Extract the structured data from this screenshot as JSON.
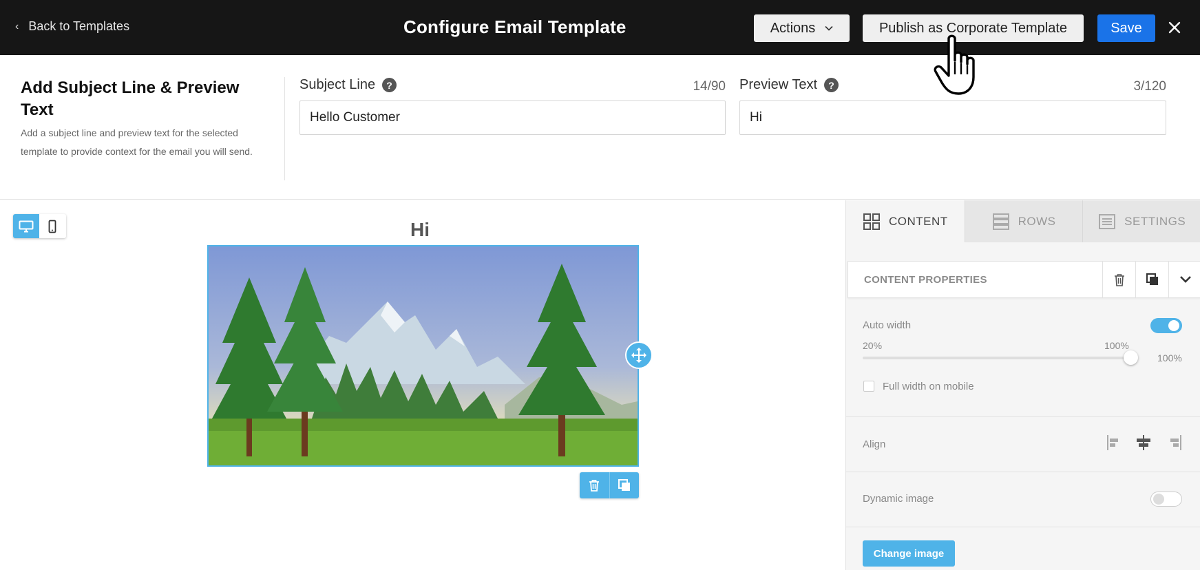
{
  "header": {
    "back_label": "Back to Templates",
    "title": "Configure Email Template",
    "actions_label": "Actions",
    "publish_label": "Publish as Corporate Template",
    "save_label": "Save"
  },
  "subject_section": {
    "title": "Add Subject Line & Preview Text",
    "description": "Add a subject line and preview text for the selected template to provide context for the email you will send.",
    "subject_line": {
      "label": "Subject Line",
      "counter": "14/90",
      "value": "Hello Customer"
    },
    "preview_text": {
      "label": "Preview Text",
      "counter": "3/120",
      "value": "Hi"
    }
  },
  "canvas": {
    "heading": "Hi",
    "devices": [
      "desktop",
      "mobile"
    ],
    "active_device": "desktop"
  },
  "panel": {
    "tabs": [
      {
        "label": "CONTENT",
        "icon": "grid-icon",
        "active": true
      },
      {
        "label": "ROWS",
        "icon": "rows-icon",
        "active": false
      },
      {
        "label": "SETTINGS",
        "icon": "settings-icon",
        "active": false
      }
    ],
    "properties_title": "CONTENT PROPERTIES",
    "auto_width": {
      "label": "Auto width",
      "enabled": true
    },
    "width_slider": {
      "min_label": "20%",
      "max_label": "100%",
      "value_label": "100%",
      "value": 100
    },
    "full_width_mobile": {
      "label": "Full width on mobile",
      "checked": false
    },
    "align": {
      "label": "Align",
      "options": [
        "left",
        "center",
        "right"
      ],
      "selected": "center"
    },
    "dynamic_image": {
      "label": "Dynamic image",
      "enabled": false
    },
    "change_image_label": "Change image"
  },
  "colors": {
    "topbar": "#161616",
    "save_blue": "#1a73e8",
    "accent": "#4fb3e8"
  }
}
